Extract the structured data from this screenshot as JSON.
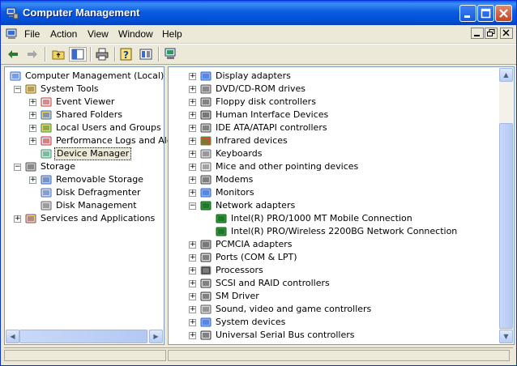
{
  "window": {
    "title": "Computer Management"
  },
  "menu": [
    "File",
    "Action",
    "View",
    "Window",
    "Help"
  ],
  "left_tree": [
    {
      "label": "Computer Management (Local)",
      "icon": "computer-management-icon",
      "expander": "none",
      "indent": 0
    },
    {
      "label": "System Tools",
      "icon": "system-tools-icon",
      "expander": "minus",
      "indent": 1
    },
    {
      "label": "Event Viewer",
      "icon": "event-viewer-icon",
      "expander": "plus",
      "indent": 2
    },
    {
      "label": "Shared Folders",
      "icon": "shared-folders-icon",
      "expander": "plus",
      "indent": 2
    },
    {
      "label": "Local Users and Groups",
      "icon": "users-icon",
      "expander": "plus",
      "indent": 2
    },
    {
      "label": "Performance Logs and Alerts",
      "icon": "performance-icon",
      "expander": "plus",
      "indent": 2
    },
    {
      "label": "Device Manager",
      "icon": "device-manager-icon",
      "expander": "none",
      "indent": 2,
      "selected": true
    },
    {
      "label": "Storage",
      "icon": "storage-icon",
      "expander": "minus",
      "indent": 1
    },
    {
      "label": "Removable Storage",
      "icon": "removable-storage-icon",
      "expander": "plus",
      "indent": 2
    },
    {
      "label": "Disk Defragmenter",
      "icon": "defrag-icon",
      "expander": "none",
      "indent": 2
    },
    {
      "label": "Disk Management",
      "icon": "disk-management-icon",
      "expander": "none",
      "indent": 2
    },
    {
      "label": "Services and Applications",
      "icon": "services-icon",
      "expander": "plus",
      "indent": 1
    }
  ],
  "right_tree": [
    {
      "label": "Display adapters",
      "icon": "display-adapter-icon",
      "expander": "plus",
      "indent": 0
    },
    {
      "label": "DVD/CD-ROM drives",
      "icon": "cdrom-icon",
      "expander": "plus",
      "indent": 0
    },
    {
      "label": "Floppy disk controllers",
      "icon": "floppy-controller-icon",
      "expander": "plus",
      "indent": 0
    },
    {
      "label": "Human Interface Devices",
      "icon": "hid-icon",
      "expander": "plus",
      "indent": 0
    },
    {
      "label": "IDE ATA/ATAPI controllers",
      "icon": "ide-controller-icon",
      "expander": "plus",
      "indent": 0
    },
    {
      "label": "Infrared devices",
      "icon": "infrared-icon",
      "expander": "plus",
      "indent": 0
    },
    {
      "label": "Keyboards",
      "icon": "keyboard-icon",
      "expander": "plus",
      "indent": 0
    },
    {
      "label": "Mice and other pointing devices",
      "icon": "mouse-icon",
      "expander": "plus",
      "indent": 0
    },
    {
      "label": "Modems",
      "icon": "modem-icon",
      "expander": "plus",
      "indent": 0
    },
    {
      "label": "Monitors",
      "icon": "monitor-icon",
      "expander": "plus",
      "indent": 0
    },
    {
      "label": "Network adapters",
      "icon": "network-adapter-icon",
      "expander": "minus",
      "indent": 0
    },
    {
      "label": "Intel(R) PRO/1000 MT Mobile Connection",
      "icon": "network-card-icon",
      "expander": "none",
      "indent": 1
    },
    {
      "label": "Intel(R) PRO/Wireless 2200BG Network Connection",
      "icon": "network-card-icon",
      "expander": "none",
      "indent": 1
    },
    {
      "label": "PCMCIA adapters",
      "icon": "pcmcia-icon",
      "expander": "plus",
      "indent": 0
    },
    {
      "label": "Ports (COM & LPT)",
      "icon": "ports-icon",
      "expander": "plus",
      "indent": 0
    },
    {
      "label": "Processors",
      "icon": "processor-icon",
      "expander": "plus",
      "indent": 0
    },
    {
      "label": "SCSI and RAID controllers",
      "icon": "scsi-icon",
      "expander": "plus",
      "indent": 0
    },
    {
      "label": "SM Driver",
      "icon": "sm-driver-icon",
      "expander": "plus",
      "indent": 0
    },
    {
      "label": "Sound, video and game controllers",
      "icon": "sound-icon",
      "expander": "plus",
      "indent": 0
    },
    {
      "label": "System devices",
      "icon": "system-devices-icon",
      "expander": "plus",
      "indent": 0
    },
    {
      "label": "Universal Serial Bus controllers",
      "icon": "usb-icon",
      "expander": "plus",
      "indent": 0
    }
  ],
  "colors": {
    "title_bar": "#0a5fe6",
    "face": "#ece9d8",
    "pane_border": "#7f9db9"
  }
}
